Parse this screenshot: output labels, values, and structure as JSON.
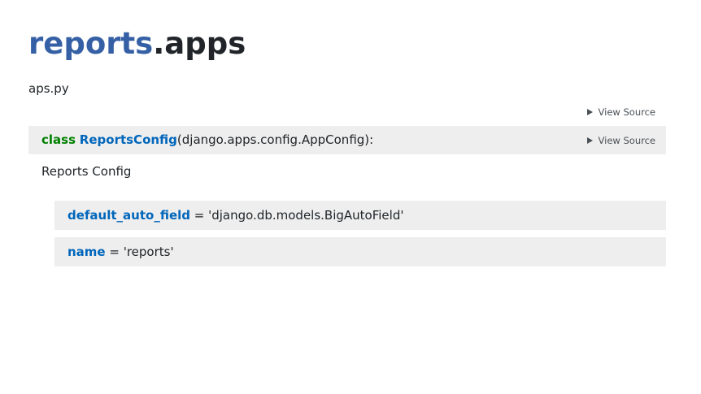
{
  "title": {
    "module_link": "reports",
    "module_rest": ".apps"
  },
  "module_docstring": "aps.py",
  "view_source_label": "View Source",
  "class": {
    "keyword": "class",
    "name": "ReportsConfig",
    "signature_rest": "(django.apps.config.AppConfig):",
    "docstring": "Reports Config"
  },
  "attributes": [
    {
      "name": "default_auto_field",
      "value": " = 'django.db.models.BigAutoField'"
    },
    {
      "name": "name",
      "value": " = 'reports'"
    }
  ]
}
